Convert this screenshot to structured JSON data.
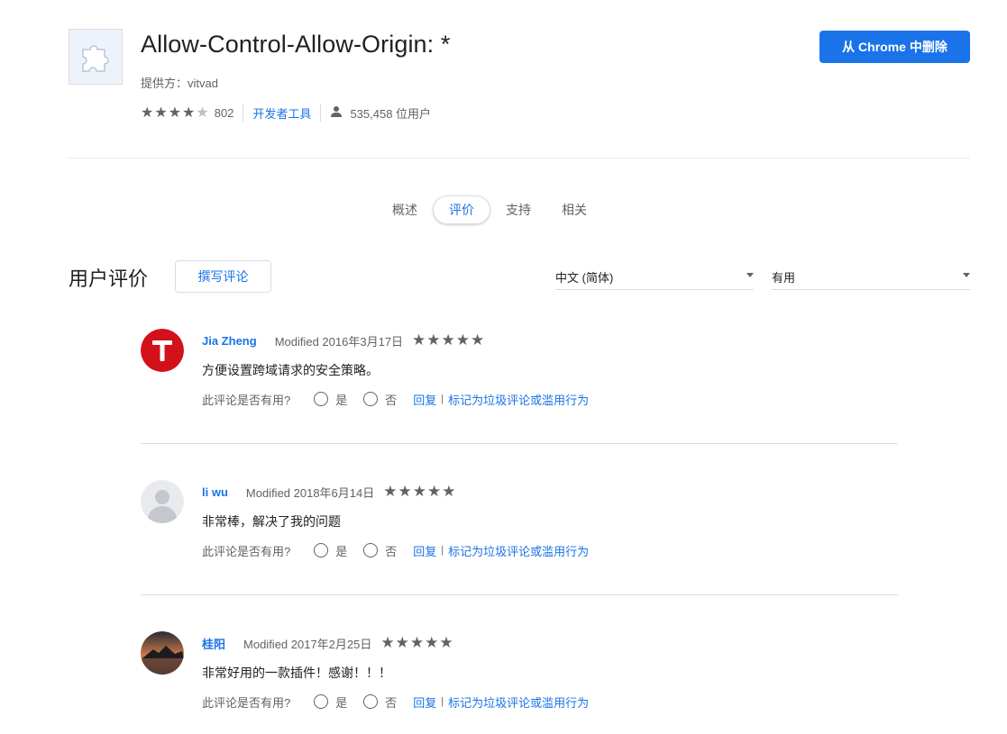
{
  "extension": {
    "title": "Allow-Control-Allow-Origin: *",
    "provider": "提供方：vitvad",
    "rating": 4,
    "rating_count": "802",
    "category": "开发者工具",
    "users": "535,458 位用户",
    "remove_label": "从 Chrome 中删除",
    "icon": "puzzle-piece-icon"
  },
  "tabs": [
    {
      "label": "概述",
      "active": false
    },
    {
      "label": "评价",
      "active": true
    },
    {
      "label": "支持",
      "active": false
    },
    {
      "label": "相关",
      "active": false
    }
  ],
  "reviews_section": {
    "title": "用户评价",
    "write_label": "撰写评论",
    "language_filter": "中文 (简体)",
    "sort_filter": "有用"
  },
  "reviews": [
    {
      "name": "Jia Zheng",
      "date": "Modified 2016年3月17日",
      "stars": 5,
      "text": "方便设置跨域请求的安全策略。",
      "avatar": "red-circle-T-avatar"
    },
    {
      "name": "li wu",
      "date": "Modified 2018年6月14日",
      "stars": 5,
      "text": "非常棒，解决了我的问题",
      "avatar": "default-silhouette-avatar"
    },
    {
      "name": "桂阳",
      "date": "Modified 2017年2月25日",
      "stars": 5,
      "text": "非常好用的一款插件！感谢！！！",
      "avatar": "landscape-photo-avatar"
    }
  ],
  "review_actions": {
    "helpful_question": "此评论是否有用?",
    "yes": "是",
    "no": "否",
    "reply": "回复",
    "separator": "|",
    "report": "标记为垃圾评论或滥用行为"
  },
  "colors": {
    "accent": "#1a73e8",
    "text_secondary": "#5f6368",
    "divider": "#dadce0"
  }
}
